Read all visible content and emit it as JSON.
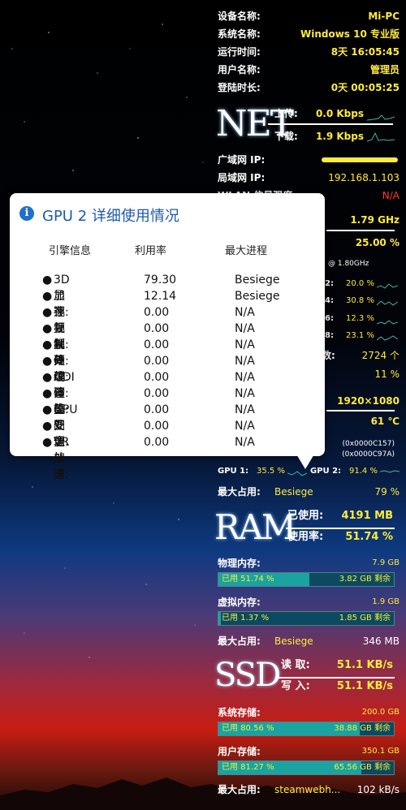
{
  "system": {
    "rows": [
      {
        "key": "设备名称:",
        "value": "Mi-PC"
      },
      {
        "key": "系统名称:",
        "value": "Windows 10 专业版"
      },
      {
        "key": "运行时间:",
        "value": "8天 16:05:45"
      },
      {
        "key": "用户名称:",
        "value": "管理员"
      },
      {
        "key": "登陆时长:",
        "value": "0天 00:05:25"
      }
    ]
  },
  "net": {
    "logo": "NET",
    "upload_label": "上传:",
    "upload_value": "0.0 Kbps",
    "download_label": "下载:",
    "download_value": "1.9 Kbps",
    "wan_label": "广域网 IP:",
    "lan_label": "局域网 IP:",
    "lan_value": "192.168.1.103",
    "wlan_label": "WLAN 信号强度",
    "wlan_value": "N/A"
  },
  "cpu": {
    "freq": "1.79 GHz",
    "usage": "25.00 %",
    "base_freq": "@ 1.80GHz",
    "cores": [
      {
        "id": "2:",
        "value": "20.0 %"
      },
      {
        "id": "4:",
        "value": "30.8 %"
      },
      {
        "id": "6:",
        "value": "12.3 %"
      },
      {
        "id": "8:",
        "value": "23.1 %"
      }
    ],
    "threads_label": "线程数:",
    "threads_value": "2724 个",
    "other_pct": "11 %"
  },
  "display": {
    "resolution": "1920×1080",
    "temp": "61 ℃",
    "id1": "(0x0000C157)",
    "id2": "(0x0000C97A)",
    "gpu1_label": "GPU 1:",
    "gpu1_value": "35.5 %",
    "gpu2_label": "GPU 2:",
    "gpu2_value": "91.4 %",
    "max_label": "最大占用:",
    "max_proc": "Besiege",
    "max_value": "79 %"
  },
  "ram": {
    "logo": "RAM",
    "used_label": "已使用:",
    "used_value": "4191 MB",
    "rate_label": "使用率:",
    "rate_value": "51.74 %",
    "phys_label": "物理内存:",
    "phys_total": "7.9 GB",
    "phys_used": "已用 51.74 %",
    "phys_fill": 0.5174,
    "phys_free": "3.82 GB 剩余",
    "virt_label": "虚拟内存:",
    "virt_total": "1.9 GB",
    "virt_used": "已用 1.37 %",
    "virt_fill": 0.0137,
    "virt_free": "1.85 GB 剩余",
    "max_label": "最大占用:",
    "max_proc": "Besiege",
    "max_value": "346 MB"
  },
  "ssd": {
    "logo": "SSD",
    "read_label": "读  取:",
    "read_value": "51.1 KB/s",
    "write_label": "写  入:",
    "write_value": "51.1 KB/s",
    "sys_label": "系统存储:",
    "sys_total": "200.0 GB",
    "sys_used": "已用 80.56 %",
    "sys_fill": 0.8056,
    "sys_free": "38.88 GB 剩余",
    "user_label": "用户存储:",
    "user_total": "350.1 GB",
    "user_used": "已用 81.27 %",
    "user_fill": 0.8127,
    "user_free": "65.56 GB 剩余",
    "max_label": "最大占用:",
    "max_proc": "steamwebh...",
    "max_value": "102 kB/s"
  },
  "popup": {
    "icon": "info-icon",
    "title": "GPU 2 详细使用情况",
    "headers": {
      "engine": "引擎信息",
      "usage": "利用率",
      "process": "最大进程"
    },
    "rows": [
      {
        "name": "3D 加速:",
        "usage": "79.30",
        "process": "Besiege"
      },
      {
        "name": "显存复制:",
        "usage": "12.14",
        "process": "Besiege"
      },
      {
        "name": "视频解码:",
        "usage": "0.00",
        "process": "N/A"
      },
      {
        "name": "视频处理:",
        "usage": "0.00",
        "process": "N/A"
      },
      {
        "name": "视频编码:",
        "usage": "0.00",
        "process": "N/A"
      },
      {
        "name": "传统覆盖:",
        "usage": "0.00",
        "process": "N/A"
      },
      {
        "name": "GDI 渲染:",
        "usage": "0.00",
        "process": "N/A"
      },
      {
        "name": "计算处理:",
        "usage": "0.00",
        "process": "N/A"
      },
      {
        "name": "GPU 安全:",
        "usage": "0.00",
        "process": "N/A"
      },
      {
        "name": "图像处理:",
        "usage": "0.00",
        "process": "N/A"
      },
      {
        "name": "VR 加速:",
        "usage": "0.00",
        "process": "N/A"
      }
    ]
  },
  "colors": {
    "accent": "#ffeb3b",
    "bar_fill": "#1aa3a0",
    "bar_bg": "#0b4a60",
    "popup_title": "#1f5aa8"
  }
}
